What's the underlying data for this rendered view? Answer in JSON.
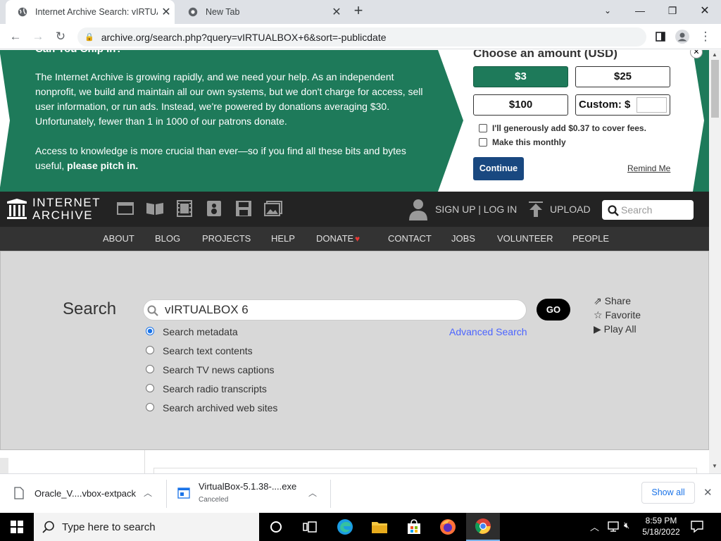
{
  "browser": {
    "tabs": [
      {
        "title": "Internet Archive Search: vIRTUAL"
      },
      {
        "title": "New Tab"
      }
    ],
    "url": "archive.org/search.php?query=vIRTUALBOX+6&sort=-publicdate"
  },
  "donation": {
    "heading_partial": "Can You Chip In?",
    "para1": "The Internet Archive is growing rapidly, and we need your help. As an independent nonprofit, we build and maintain all our own systems, but we don't charge for access, sell user information, or run ads. Instead, we're powered by donations averaging $30. Unfortunately, fewer than 1 in 1000 of our patrons donate.",
    "para2": "Access to knowledge is more crucial than ever—so if you find all these bits and bytes useful,",
    "para2_bold": "please pitch in.",
    "choose_title": "Choose an amount (USD)",
    "amounts": [
      "$3",
      "$25",
      "$100"
    ],
    "custom_label": "Custom: $",
    "fee_label": "I'll generously add $0.37 to cover fees.",
    "monthly_label": "Make this monthly",
    "continue": "Continue",
    "remind": "Remind Me",
    "accent": "#1e7a5a",
    "continue_color": "#194880"
  },
  "ia": {
    "logo_line1": "INTERNET",
    "logo_line2": "ARCHIVE",
    "signup": "SIGN UP | LOG IN",
    "upload": "UPLOAD",
    "search_placeholder": "Search",
    "nav": [
      "ABOUT",
      "BLOG",
      "PROJECTS",
      "HELP",
      "DONATE",
      "CONTACT",
      "JOBS",
      "VOLUNTEER",
      "PEOPLE"
    ]
  },
  "search": {
    "label": "Search",
    "query": "vIRTUALBOX 6",
    "go": "GO",
    "advanced": "Advanced Search",
    "options": [
      "Search metadata",
      "Search text contents",
      "Search TV news captions",
      "Search radio transcripts",
      "Search archived web sites"
    ],
    "selected_option": "Search metadata",
    "share": "Share",
    "favorite": "Favorite",
    "play_all": "Play All"
  },
  "downloads": {
    "items": [
      {
        "name": "Oracle_V....vbox-extpack",
        "status": ""
      },
      {
        "name": "VirtualBox-5.1.38-....exe",
        "status": "Canceled"
      }
    ],
    "show_all": "Show all"
  },
  "taskbar": {
    "search_placeholder": "Type here to search",
    "time": "8:59 PM",
    "date": "5/18/2022"
  }
}
